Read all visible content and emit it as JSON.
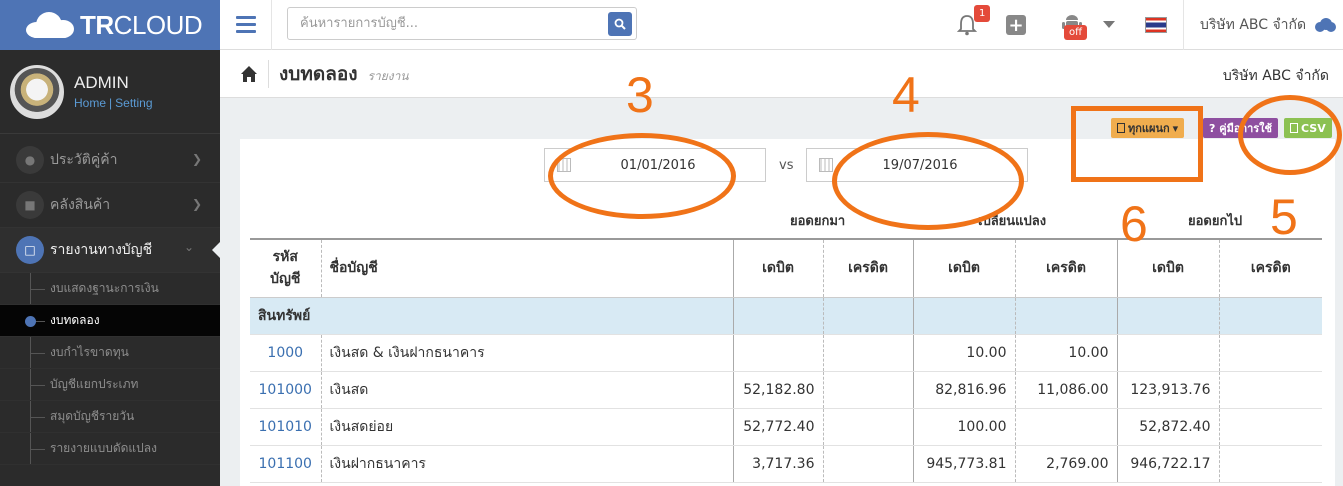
{
  "logo": {
    "text_bold": "TR",
    "text_rest": "CLOUD"
  },
  "user": {
    "name": "ADMIN",
    "home_link": "Home",
    "separator": "|",
    "setting_link": "Setting"
  },
  "sidebar": {
    "menu": [
      {
        "label": "ประวัติคู่ค้า",
        "icon": "people-icon"
      },
      {
        "label": "คลังสินค้า",
        "icon": "truck-icon"
      },
      {
        "label": "รายงานทางบัญชี",
        "icon": "report-icon",
        "active": true
      }
    ],
    "submenu": [
      {
        "label": "งบแสดงฐานะการเงิน"
      },
      {
        "label": "งบทดลอง",
        "current": true
      },
      {
        "label": "งบกำไรขาดทุน"
      },
      {
        "label": "บัญชีแยกประเภท"
      },
      {
        "label": "สมุดบัญชีรายวัน"
      },
      {
        "label": "รายงายแบบดัดแปลง"
      }
    ]
  },
  "topbar": {
    "search_placeholder": "ค้นหารายการบัญชี...",
    "notification_count": "1",
    "android_status": "off",
    "company": "บริษัท ABC จำกัด"
  },
  "breadcrumb": {
    "title": "งบทดลอง",
    "subtitle": "รายงาน",
    "company": "บริษัท ABC จำกัด"
  },
  "actions": {
    "plan_label": "ทุกแผนก",
    "guide_label": "? คู่มือการใช้",
    "csv_label": "CSV"
  },
  "filters": {
    "date_from": "01/01/2016",
    "vs_label": "vs",
    "date_to": "19/07/2016"
  },
  "table": {
    "group_headers": {
      "opening": "ยอดยกมา",
      "change": "เปลี่ยนแปลง",
      "closing": "ยอดยกไป"
    },
    "columns": {
      "code_line1": "รหัส",
      "code_line2": "บัญชี",
      "name": "ชื่อบัญชี",
      "debit": "เดบิต",
      "credit": "เครดิต"
    },
    "section_label": "สินทรัพย์",
    "rows": [
      {
        "code": "1000",
        "name": "เงินสด & เงินฝากธนาคาร",
        "open_dr": "",
        "open_cr": "",
        "chg_dr": "10.00",
        "chg_cr": "10.00",
        "close_dr": "",
        "close_cr": ""
      },
      {
        "code": "101000",
        "name": "เงินสด",
        "open_dr": "52,182.80",
        "open_cr": "",
        "chg_dr": "82,816.96",
        "chg_cr": "11,086.00",
        "close_dr": "123,913.76",
        "close_cr": ""
      },
      {
        "code": "101010",
        "name": "เงินสดย่อย",
        "open_dr": "52,772.40",
        "open_cr": "",
        "chg_dr": "100.00",
        "chg_cr": "",
        "close_dr": "52,872.40",
        "close_cr": ""
      },
      {
        "code": "101100",
        "name": "เงินฝากธนาคาร",
        "open_dr": "3,717.36",
        "open_cr": "",
        "chg_dr": "945,773.81",
        "chg_cr": "2,769.00",
        "close_dr": "946,722.17",
        "close_cr": ""
      }
    ]
  },
  "annotations": {
    "n3": "3",
    "n4": "4",
    "n5": "5",
    "n6": "6",
    "color": "#f07318"
  }
}
